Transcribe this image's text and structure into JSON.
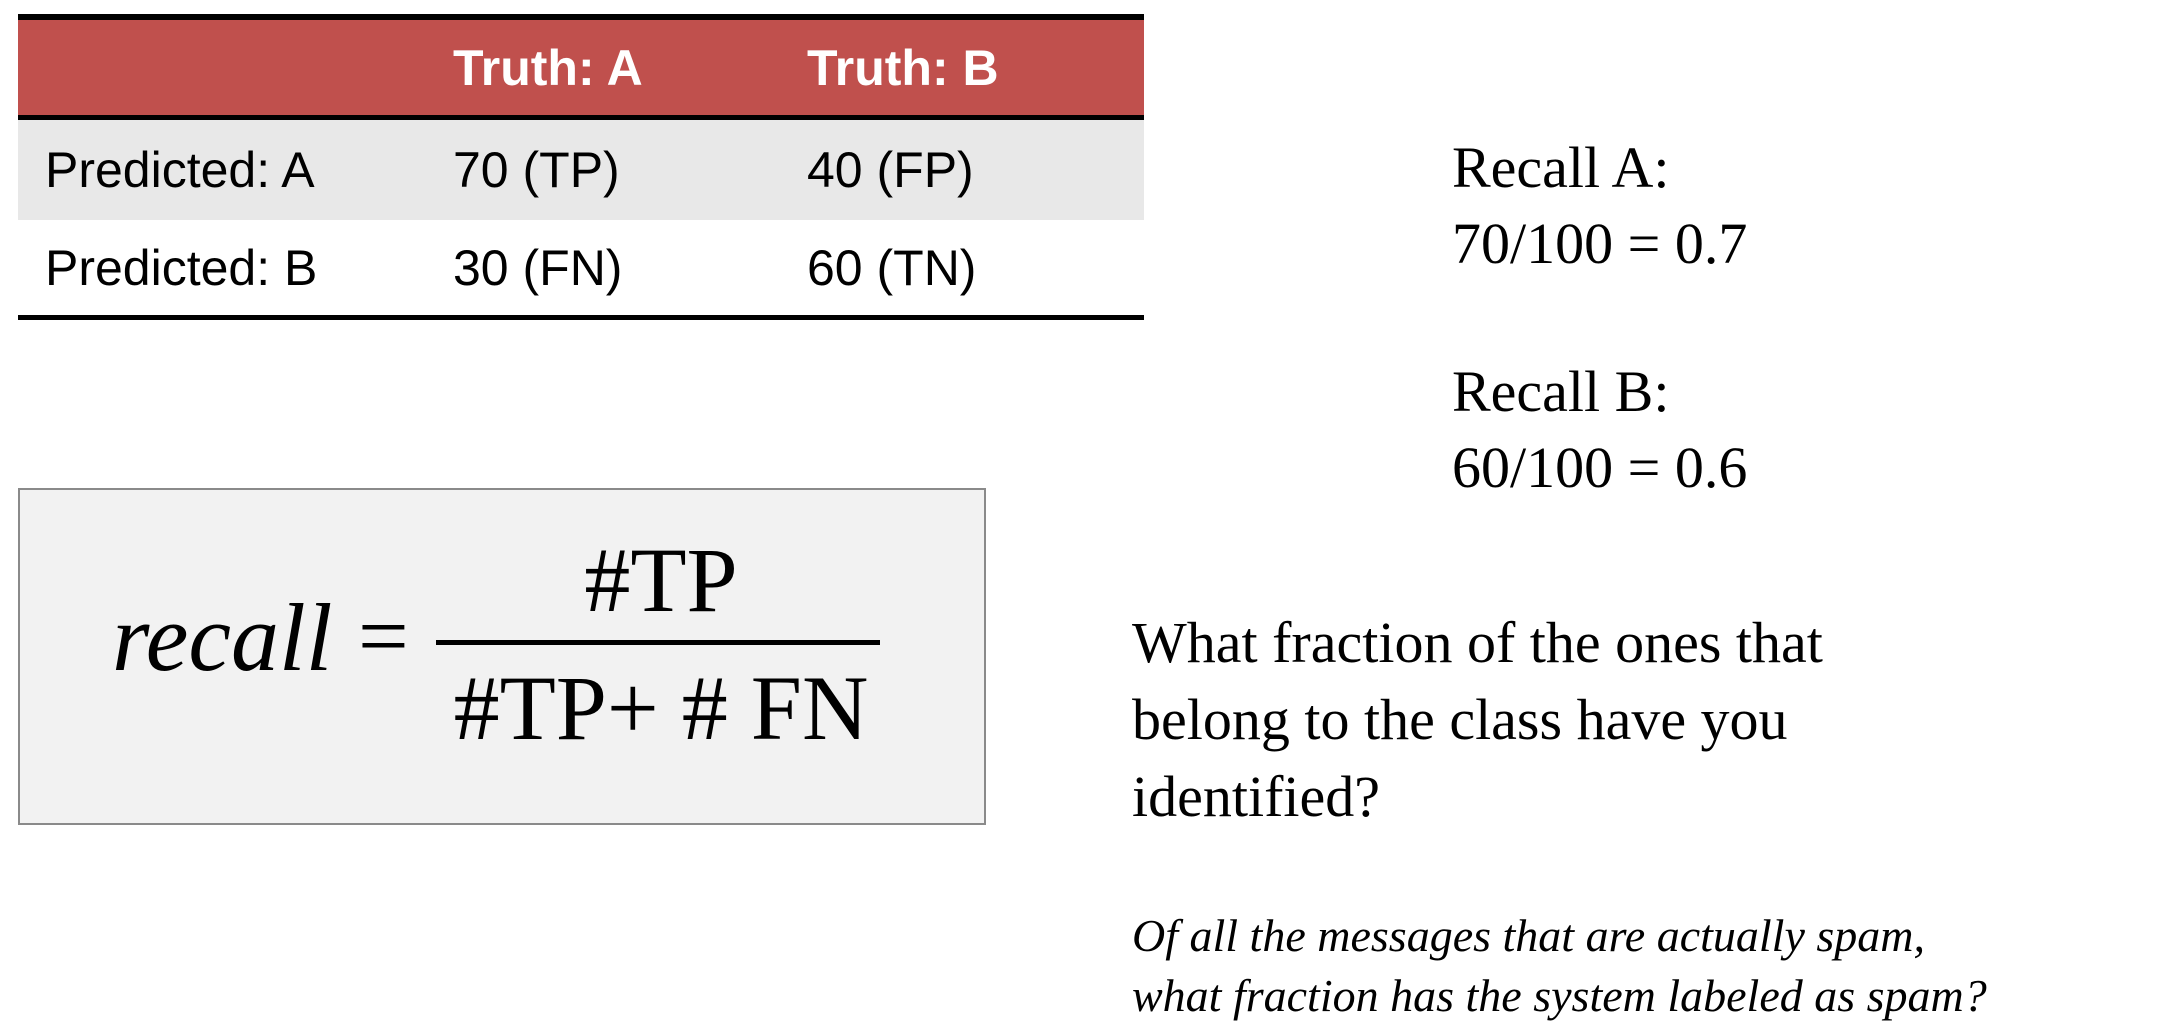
{
  "colors": {
    "header_bg": "#c0504d",
    "row_shade": "#e8e8e8",
    "formula_box_bg": "#f2f2f2",
    "formula_box_border": "#8a8a8a"
  },
  "table": {
    "header": [
      "",
      "Truth: A",
      "Truth: B"
    ],
    "rows": [
      [
        "Predicted: A",
        "70 (TP)",
        "40 (FP)"
      ],
      [
        "Predicted: B",
        "30 (FN)",
        "60 (TN)"
      ]
    ]
  },
  "formula": {
    "lhs": "recall",
    "equals": "=",
    "numerator": "#TP",
    "denominator": "#TP+ # FN"
  },
  "recall_a": {
    "label": "Recall A:",
    "value": "70/100 = 0.7"
  },
  "recall_b": {
    "label": "Recall B:",
    "value": "60/100 = 0.6"
  },
  "question": {
    "lines": [
      "What fraction of the ones that",
      "belong to the class have you",
      "identified?"
    ]
  },
  "example": {
    "lines": [
      "Of all the messages that are actually spam,",
      "what fraction has the system labeled as spam?"
    ]
  }
}
